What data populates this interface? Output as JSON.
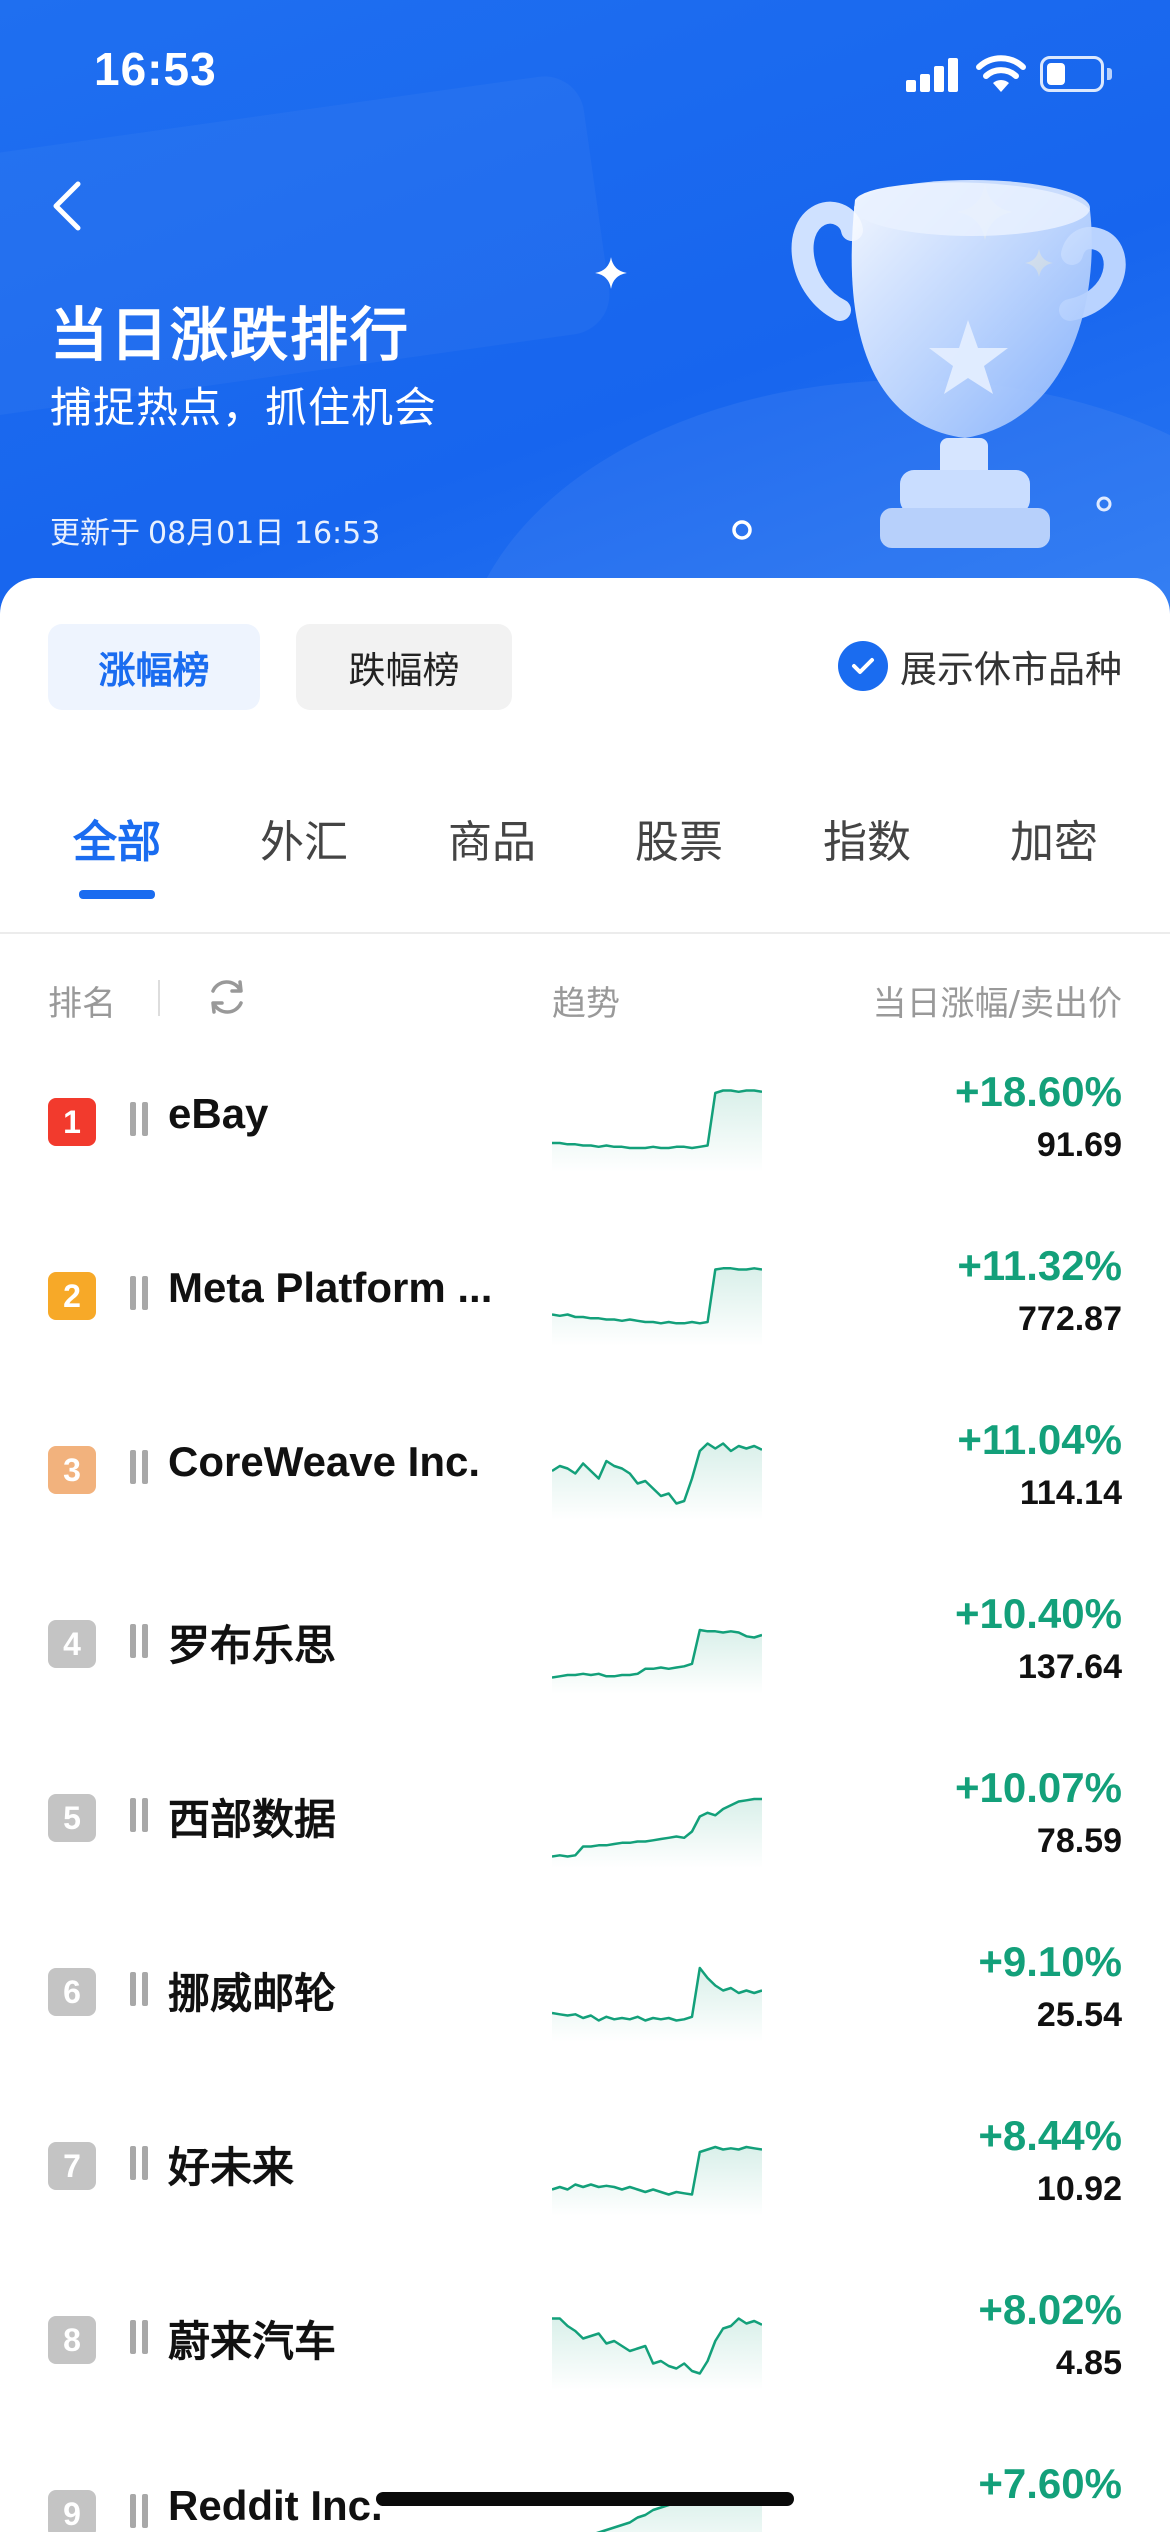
{
  "status_bar": {
    "time": "16:53",
    "battery_level": 0.35
  },
  "header": {
    "title": "当日涨跌排行",
    "subtitle": "捕捉热点，抓住机会",
    "update_prefix": "更新于",
    "update_time": "08月01日 16:53"
  },
  "toggles": {
    "gainers": "涨幅榜",
    "losers": "跌幅榜",
    "active": "gainers"
  },
  "show_closed": {
    "label": "展示休市品种",
    "checked": true
  },
  "tabs": [
    "全部",
    "外汇",
    "商品",
    "股票",
    "指数",
    "加密"
  ],
  "active_tab": 0,
  "columns": {
    "rank": "排名",
    "trend": "趋势",
    "change_price": "当日涨幅/卖出价"
  },
  "colors": {
    "header_blue": "#1f6ff0",
    "accent_blue": "#1a6cf0",
    "gain_green": "#13a07a",
    "rank1": "#f23a2d",
    "rank2": "#f7a928",
    "rank3": "#f2b27d",
    "rank_other": "#c4c4c4"
  },
  "rows": [
    {
      "rank": "1",
      "name": "eBay",
      "change": "+18.60%",
      "price": "91.69",
      "trend": [
        20,
        20,
        19,
        19,
        18,
        18,
        17,
        18,
        17,
        17,
        16,
        16,
        16,
        17,
        16,
        16,
        17,
        17,
        16,
        17,
        18,
        60,
        62,
        62,
        61,
        62,
        62,
        61
      ]
    },
    {
      "rank": "2",
      "name": "Meta Platform ...",
      "change": "+11.32%",
      "price": "772.87",
      "trend": [
        22,
        21,
        22,
        20,
        20,
        19,
        19,
        18,
        18,
        17,
        18,
        17,
        16,
        16,
        15,
        16,
        15,
        15,
        16,
        15,
        16,
        58,
        59,
        59,
        58,
        58,
        59,
        58
      ]
    },
    {
      "rank": "3",
      "name": "CoreWeave Inc.",
      "change": "+11.04%",
      "price": "114.14",
      "trend": [
        36,
        40,
        38,
        34,
        42,
        36,
        30,
        44,
        40,
        38,
        34,
        26,
        28,
        22,
        16,
        18,
        10,
        12,
        30,
        52,
        58,
        54,
        58,
        52,
        56,
        54,
        56,
        53
      ]
    },
    {
      "rank": "4",
      "name": "罗布乐思",
      "change": "+10.40%",
      "price": "137.64",
      "trend": [
        10,
        11,
        12,
        12,
        13,
        12,
        13,
        11,
        11,
        12,
        12,
        13,
        17,
        17,
        18,
        17,
        18,
        19,
        21,
        48,
        47,
        47,
        46,
        47,
        46,
        43,
        42,
        44
      ]
    },
    {
      "rank": "5",
      "name": "西部数据",
      "change": "+10.07%",
      "price": "78.59",
      "trend": [
        6,
        7,
        6,
        7,
        14,
        14,
        15,
        15,
        16,
        17,
        17,
        18,
        18,
        19,
        20,
        21,
        22,
        21,
        26,
        38,
        41,
        39,
        44,
        47,
        50,
        51,
        52,
        52
      ]
    },
    {
      "rank": "6",
      "name": "挪威邮轮",
      "change": "+9.10%",
      "price": "25.54",
      "trend": [
        20,
        19,
        18,
        19,
        16,
        18,
        14,
        17,
        15,
        16,
        15,
        17,
        14,
        16,
        15,
        16,
        14,
        15,
        17,
        56,
        48,
        42,
        38,
        40,
        36,
        38,
        36,
        38
      ]
    },
    {
      "rank": "7",
      "name": "好未来",
      "change": "+8.44%",
      "price": "10.92",
      "trend": [
        18,
        20,
        18,
        22,
        20,
        22,
        20,
        21,
        20,
        18,
        20,
        18,
        16,
        18,
        16,
        14,
        16,
        15,
        14,
        48,
        50,
        52,
        50,
        51,
        50,
        52,
        51,
        50
      ]
    },
    {
      "rank": "8",
      "name": "蔚来汽车",
      "change": "+8.02%",
      "price": "4.85",
      "trend": [
        54,
        54,
        48,
        44,
        38,
        40,
        42,
        34,
        36,
        32,
        28,
        30,
        32,
        18,
        20,
        16,
        14,
        18,
        12,
        10,
        20,
        36,
        46,
        48,
        54,
        50,
        52,
        49
      ]
    },
    {
      "rank": "9",
      "name": "Reddit Inc.",
      "change": "+7.60%",
      "price": "",
      "trend": [
        10,
        12,
        14,
        16,
        18,
        20,
        22,
        24,
        26,
        28,
        30,
        34,
        36,
        40,
        42,
        44,
        46,
        48,
        50,
        52,
        50,
        48,
        46,
        48,
        50,
        52,
        50,
        48
      ]
    }
  ]
}
